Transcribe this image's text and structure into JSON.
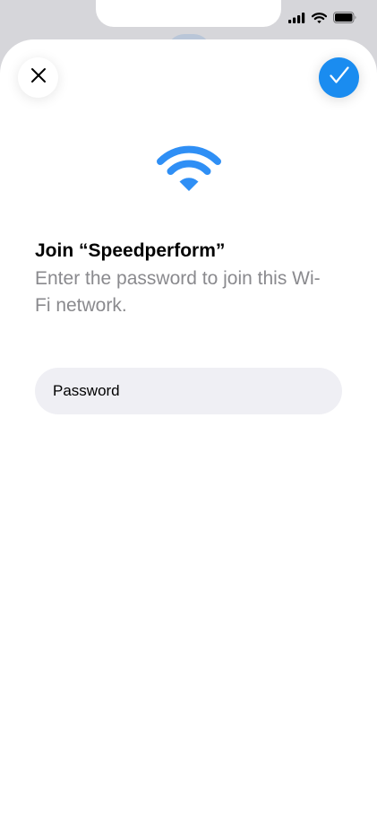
{
  "status_bar": {
    "signal_icon": "cellular-signal-icon",
    "wifi_icon": "wifi-icon",
    "battery_icon": "battery-icon"
  },
  "sheet": {
    "close_icon": "close-icon",
    "confirm_icon": "checkmark-icon",
    "hero_icon": "wifi-icon",
    "title": "Join “Speedperform”",
    "subtitle": "Enter the password to join this Wi-Fi network.",
    "password": {
      "placeholder": "Password",
      "value": ""
    }
  },
  "colors": {
    "accent": "#1a8cf0",
    "wifi_hero": "#2f8ff5",
    "subtitle": "#8a8a8e",
    "field_background": "#efeff4",
    "under_layer": "#d6d6da"
  }
}
